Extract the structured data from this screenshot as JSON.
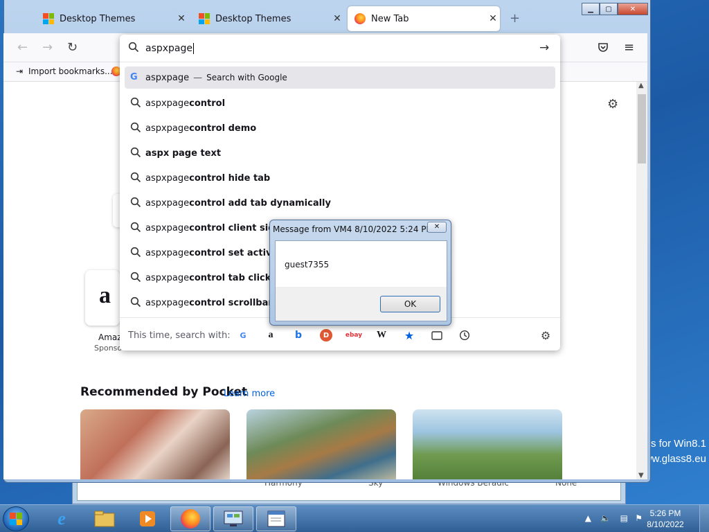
{
  "desktop": {
    "watermark_line1": "s for Win8.1",
    "watermark_line2": "www.glass8.eu",
    "behind_window": [
      "Harmony",
      "Sky",
      "Windows Beradic",
      "None"
    ]
  },
  "browser": {
    "tabs": [
      {
        "title": "Desktop Themes",
        "active": false
      },
      {
        "title": "Desktop Themes",
        "active": false
      },
      {
        "title": "New Tab",
        "active": true
      }
    ],
    "bookmarks": {
      "import_label": "Import bookmarks..."
    },
    "url_text": "aspxpage",
    "suggestions": [
      {
        "prefix": "aspxpage",
        "bold": "",
        "suffix": "Search with Google",
        "engine": true,
        "selected": true
      },
      {
        "prefix": "aspxpage",
        "bold": "control"
      },
      {
        "prefix": "aspxpage",
        "bold": "control demo"
      },
      {
        "prefix": "",
        "bold": "aspx page text"
      },
      {
        "prefix": "aspxpage",
        "bold": "control hide tab"
      },
      {
        "prefix": "aspxpage",
        "bold": "control add tab dynamically"
      },
      {
        "prefix": "aspxpage",
        "bold": "control client side"
      },
      {
        "prefix": "aspxpage",
        "bold": "control set active t"
      },
      {
        "prefix": "aspxpage",
        "bold": "control tab click e"
      },
      {
        "prefix": "aspxpage",
        "bold": "control scrollbar"
      }
    ],
    "search_with_label": "This time, search with:",
    "engines": [
      "google",
      "amazon",
      "bing",
      "duckduckgo",
      "ebay",
      "wikipedia",
      "bookmarks",
      "tabs",
      "history"
    ],
    "newtab": {
      "tile_label": "Amaz",
      "tile_sub": "Sponso",
      "pocket_title": "Recommended by Pocket",
      "learn_more": "Learn more"
    }
  },
  "dialog": {
    "title": "Message from VM4 8/10/2022 5:24 PM",
    "message": "guest7355",
    "ok_label": "OK"
  },
  "taskbar": {
    "time": "5:26 PM",
    "date": "8/10/2022"
  }
}
